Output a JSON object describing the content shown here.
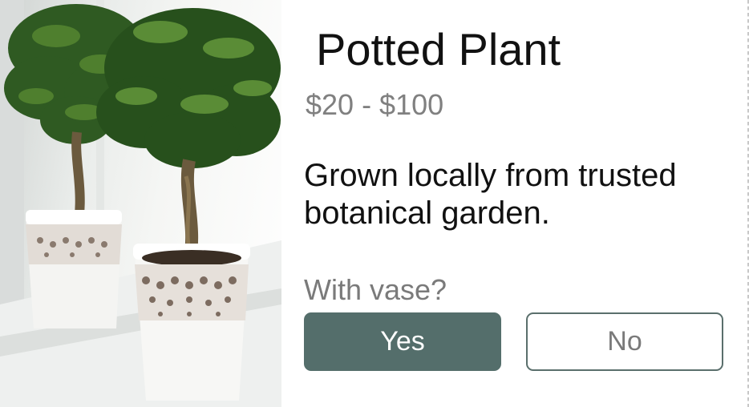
{
  "product": {
    "image": "potted-plant-photo",
    "title": "Potted Plant",
    "price_range": "$20 - $100",
    "description": "Grown locally from trusted botanical garden."
  },
  "vase_option": {
    "question": "With vase?",
    "yes_label": "Yes",
    "no_label": "No",
    "selected": "Yes"
  },
  "colors": {
    "accent": "#546e6b",
    "muted_text": "#808080",
    "primary_text": "#111111"
  }
}
